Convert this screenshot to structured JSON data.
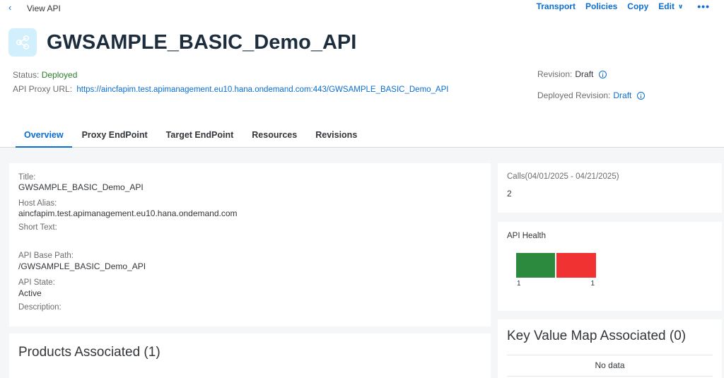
{
  "topbar": {
    "back_title": "View API",
    "actions": [
      "Transport",
      "Policies",
      "Copy",
      "Edit"
    ],
    "more": "•••"
  },
  "header": {
    "title": "GWSAMPLE_BASIC_Demo_API",
    "status_label": "Status:",
    "status_value": "Deployed",
    "proxy_url_label": "API Proxy URL:",
    "proxy_url": "https://aincfapim.test.apimanagement.eu10.hana.ondemand.com:443/GWSAMPLE_BASIC_Demo_API",
    "revision_label": "Revision:",
    "revision_value": "Draft",
    "deployed_revision_label": "Deployed Revision:",
    "deployed_revision_value": "Draft"
  },
  "tabs": [
    "Overview",
    "Proxy EndPoint",
    "Target EndPoint",
    "Resources",
    "Revisions"
  ],
  "details": {
    "title_label": "Title:",
    "title_value": "GWSAMPLE_BASIC_Demo_API",
    "host_alias_label": "Host Alias:",
    "host_alias_value": "aincfapim.test.apimanagement.eu10.hana.ondemand.com",
    "short_text_label": "Short Text:",
    "base_path_label": "API Base Path:",
    "base_path_value": "/GWSAMPLE_BASIC_Demo_API",
    "api_state_label": "API State:",
    "api_state_value": "Active",
    "description_label": "Description:"
  },
  "products": {
    "title": "Products Associated (1)"
  },
  "calls": {
    "label": "Calls(04/01/2025 - 04/21/2025)",
    "value": "2"
  },
  "health": {
    "label": "API Health"
  },
  "chart_data": {
    "type": "bar",
    "orientation": "horizontal-stacked",
    "categories": [
      "1",
      "1"
    ],
    "values": [
      1,
      1
    ],
    "colors": [
      "#2b8a3e",
      "#f03232"
    ],
    "data_labels": [
      "1",
      "1"
    ]
  },
  "kvm": {
    "title": "Key Value Map Associated (0)",
    "empty": "No data"
  },
  "colors": {
    "accent": "#0a6ed1",
    "success": "#2b7d2b",
    "health_good": "#2b8a3e",
    "health_bad": "#f03232"
  }
}
